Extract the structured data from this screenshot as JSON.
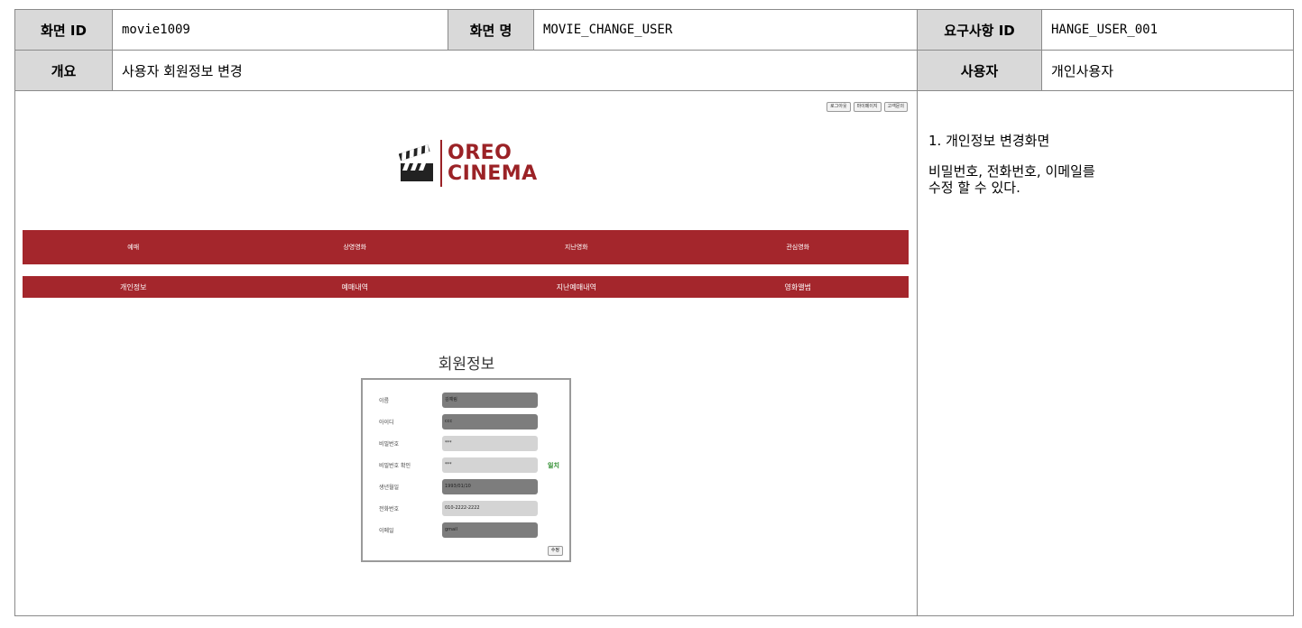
{
  "spec": {
    "screen_id_label": "화면 ID",
    "screen_id": "movie1009",
    "screen_name_label": "화면 명",
    "screen_name": "MOVIE_CHANGE_USER",
    "req_id_label": "요구사항 ID",
    "req_id": "HANGE_USER_001",
    "overview_label": "개요",
    "overview": "사용자 회원정보 변경",
    "user_label": "사용자",
    "user": "개인사용자",
    "description": [
      "1. 개인정보 변경화면",
      "비밀번호, 전화번호, 이메일를\n수정 할 수 있다."
    ]
  },
  "mockup": {
    "top_links": [
      "로그아웃",
      "마이페이지",
      "고객문의"
    ],
    "logo_line1": "OREO",
    "logo_line2": "CINEMA",
    "nav1": [
      "예매",
      "상영영화",
      "지난영화",
      "관심영화"
    ],
    "nav2": [
      "개인정보",
      "예매내역",
      "지난예매내역",
      "영화앨범"
    ],
    "form_title": "회원정보",
    "fields": [
      {
        "label": "이름",
        "value": "김예림",
        "style": "dark"
      },
      {
        "label": "아이디",
        "value": "ccc",
        "style": "dark"
      },
      {
        "label": "비밀번호",
        "value": "***",
        "style": "light"
      },
      {
        "label": "비밀번호 확인",
        "value": "***",
        "style": "light"
      },
      {
        "label": "생년월일",
        "value": "1993/01/10",
        "style": "dark"
      },
      {
        "label": "전화번호",
        "value": "010-2222-2222",
        "style": "light"
      },
      {
        "label": "이메일",
        "value": "gmail",
        "style": "dark"
      }
    ],
    "match_text": "일치",
    "submit_label": "수정"
  }
}
